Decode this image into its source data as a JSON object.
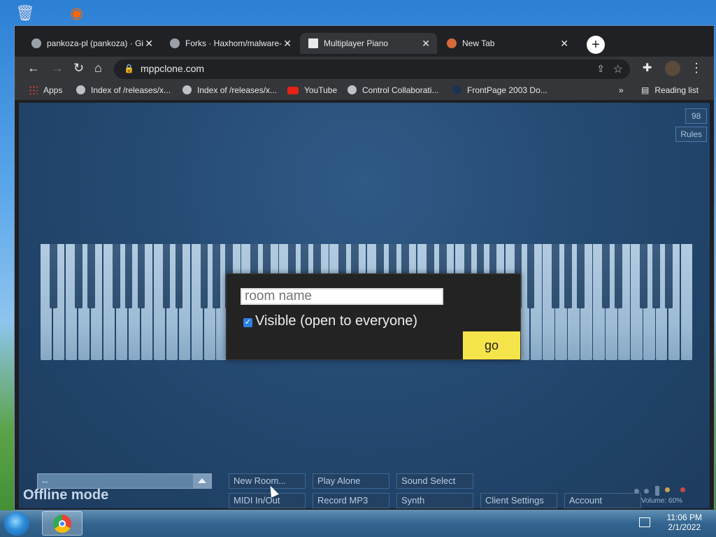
{
  "browser": {
    "tabs": [
      {
        "title": "pankoza-pl (pankoza) · Gi",
        "active": false
      },
      {
        "title": "Forks · Haxhom/malware-",
        "active": false
      },
      {
        "title": "Multiplayer Piano",
        "active": true
      },
      {
        "title": "New Tab",
        "active": false
      }
    ],
    "new_tab_label": "+",
    "url": "mppclone.com",
    "bookmarks": [
      {
        "label": "Apps",
        "icon": "apps-icon"
      },
      {
        "label": "Index of /releases/x...",
        "icon": "globe-icon"
      },
      {
        "label": "Index of /releases/x...",
        "icon": "globe-icon"
      },
      {
        "label": "YouTube",
        "icon": "youtube-icon"
      },
      {
        "label": "Control Collaborati...",
        "icon": "globe-icon"
      },
      {
        "label": "FrontPage 2003 Do...",
        "icon": "frontpage-icon"
      }
    ],
    "more_bookmarks": "»",
    "reading_list": "Reading list"
  },
  "page": {
    "top_right_small": "98",
    "rules_label": "Rules",
    "dialog": {
      "room_name_placeholder": "room name",
      "visible_label": "Visible (open to everyone)",
      "visible_checked": true,
      "go_label": "go"
    },
    "room_select_value": "--",
    "offline_label": "Offline mode",
    "buttons_row1": [
      "New Room...",
      "Play Alone",
      "Sound Select"
    ],
    "buttons_row2": [
      "MIDI In/Out",
      "Record MP3",
      "Synth",
      "Client Settings",
      "Account"
    ],
    "volume_label": "Volume: 60%"
  },
  "taskbar": {
    "time": "11:06 PM",
    "date": "2/1/2022"
  },
  "colors": {
    "page_bg": "#254a72",
    "go_button": "#f6e44b",
    "checkbox": "#2f7fe5"
  }
}
